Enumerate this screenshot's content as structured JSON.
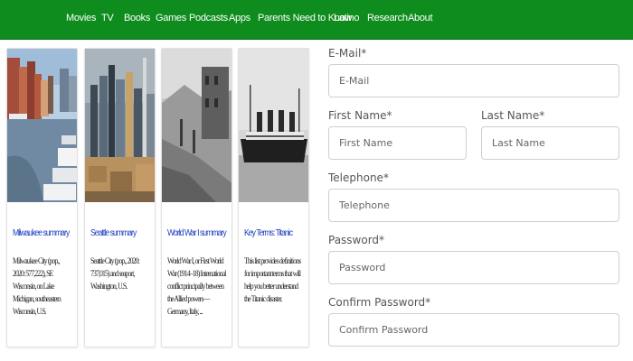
{
  "nav": {
    "items": [
      "Movies",
      "TV",
      "Books",
      "Games",
      "Podcasts",
      "Apps",
      "Parents Need to Know",
      "Latino",
      "Research",
      "About"
    ]
  },
  "cards": [
    {
      "title": "Milwaukee summary",
      "description": "Milwaukee City (pop., 2020: 577,222), SE Wisconsin, on Lake Michigan, southeastern Wisconsin, U.S."
    },
    {
      "title": "Seattle summary",
      "description": "Seattle City (pop., 2020: 737,015) and seaport, Washington, U.S."
    },
    {
      "title": "World War I summary",
      "description": "World War I, or First World War (1914–18) International conflict principally between the Allied powers—Germany, Italy, ..."
    },
    {
      "title": "Key Terms: Titanic",
      "description": "This list provides definitions for important terms that will help you better understand the Titanic disaster."
    }
  ],
  "form": {
    "email": {
      "label": "E-Mail*",
      "placeholder": "E-Mail"
    },
    "first_name": {
      "label": "First Name*",
      "placeholder": "First Name"
    },
    "last_name": {
      "label": "Last Name*",
      "placeholder": "Last Name"
    },
    "telephone": {
      "label": "Telephone*",
      "placeholder": "Telephone"
    },
    "password": {
      "label": "Password*",
      "placeholder": "Password"
    },
    "confirm_password": {
      "label": "Confirm Password*",
      "placeholder": "Confirm Password"
    }
  },
  "colors": {
    "nav_bg": "#0e8c1d",
    "link": "#1a3dbd"
  }
}
